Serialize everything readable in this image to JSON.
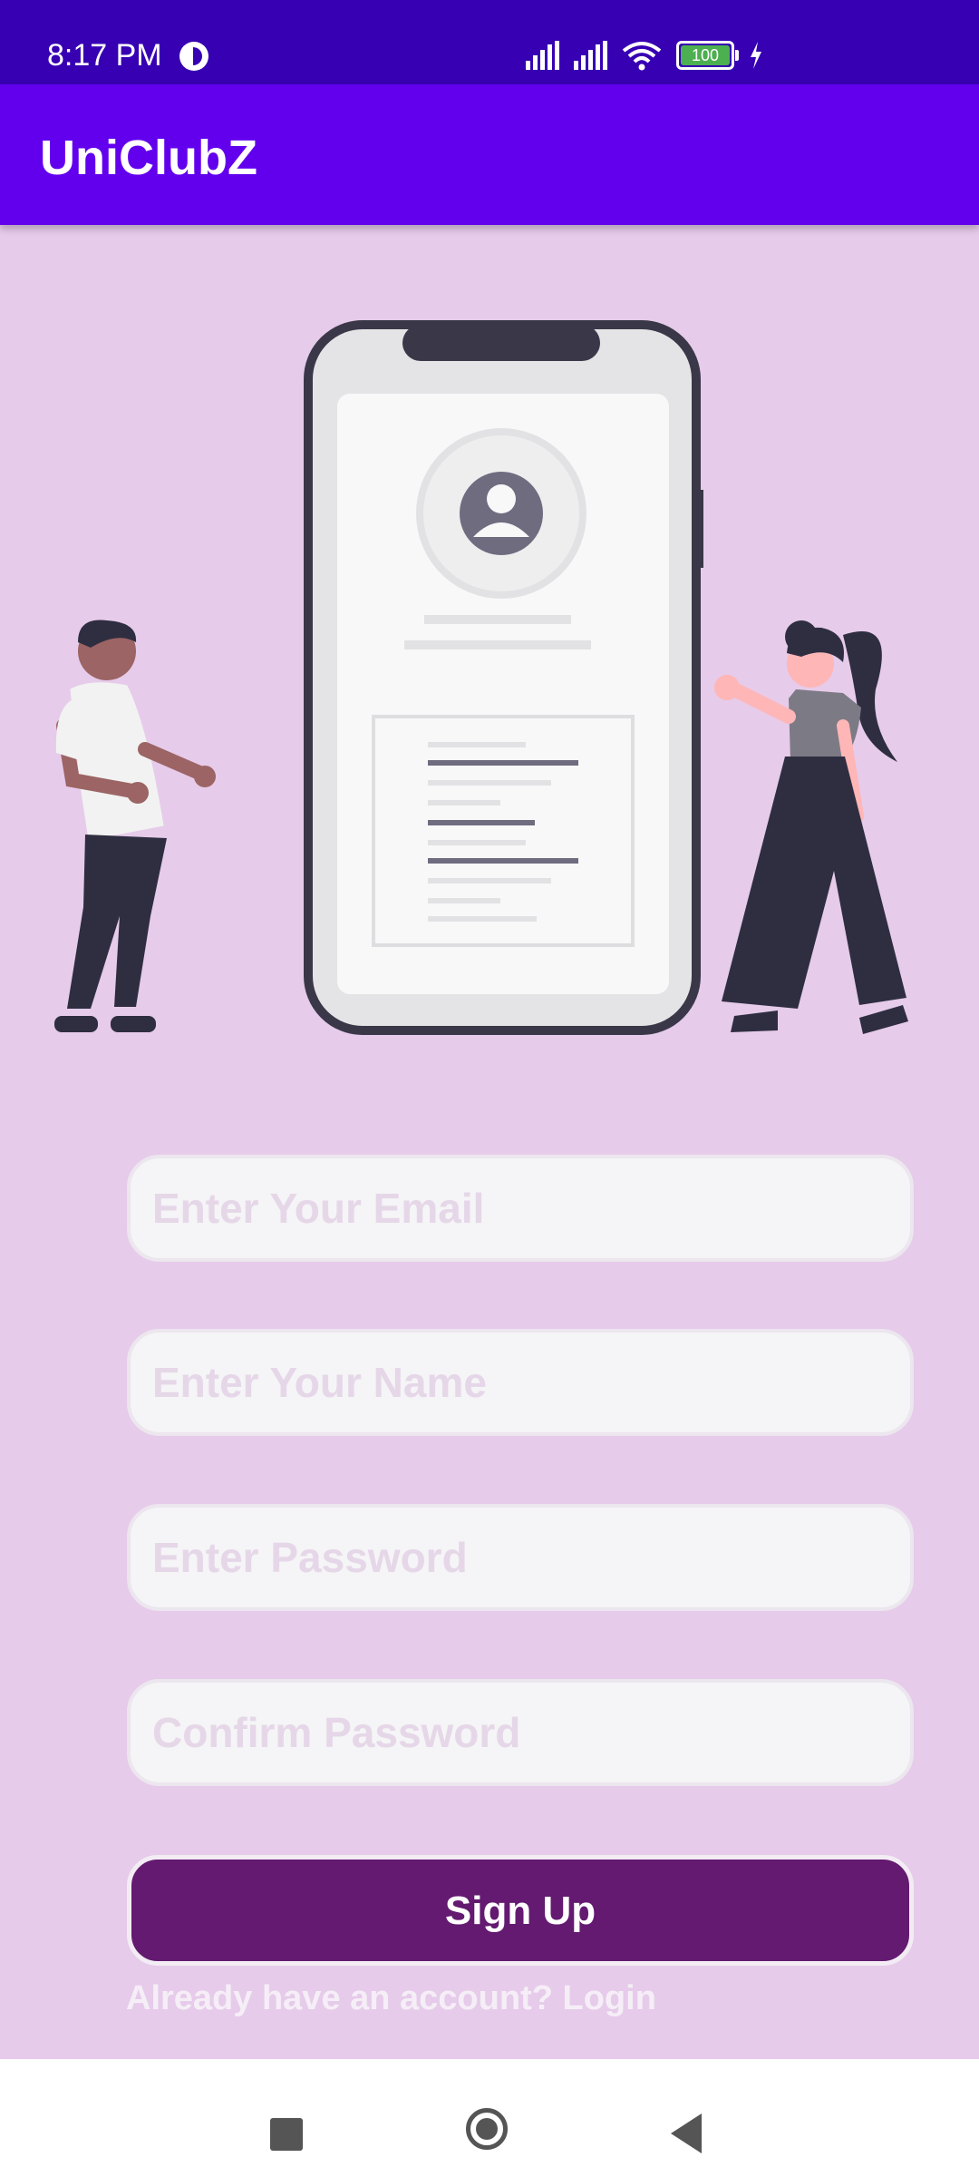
{
  "status_bar": {
    "time": "8:17 PM",
    "battery_level": "100",
    "icons": [
      "dnd-icon",
      "signal-icon",
      "signal-icon",
      "wifi-icon",
      "battery-icon",
      "charging-icon"
    ]
  },
  "app_bar": {
    "title": "UniClubZ"
  },
  "form": {
    "email_placeholder": "Enter Your Email",
    "name_placeholder": "Enter Your Name",
    "password_placeholder": "Enter Password",
    "confirm_placeholder": "Confirm Password",
    "signup_label": "Sign Up",
    "login_prompt": "Already have an account? Login"
  },
  "nav_bar": {
    "icons": [
      "recents-icon",
      "home-icon",
      "back-icon"
    ]
  },
  "colors": {
    "status_bar": "#3700b3",
    "app_bar": "#6200ee",
    "background": "#e6cbea",
    "button": "#631a70"
  }
}
